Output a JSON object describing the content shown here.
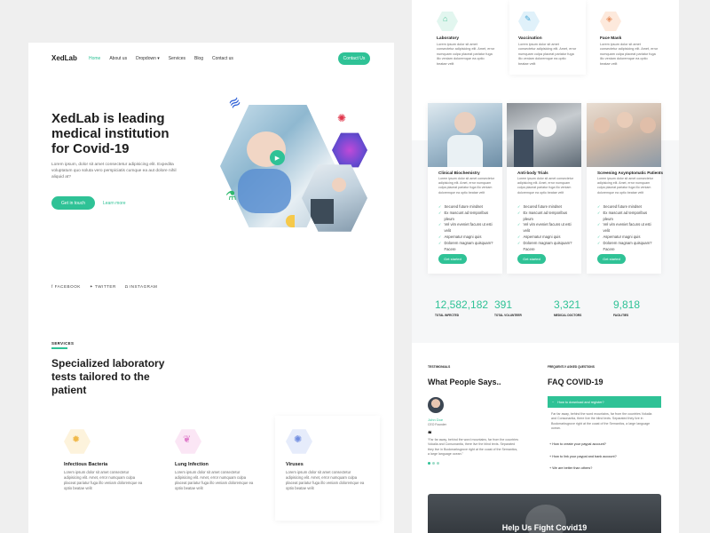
{
  "brand": "XedLab",
  "nav": {
    "items": [
      "Home",
      "About us",
      "Dropdown",
      "Services",
      "Blog",
      "Contact us"
    ],
    "cta": "Contact Us"
  },
  "hero": {
    "title_l1": "XedLab is leading",
    "title_l2": "medical institution",
    "title_l3": "for Covid-19",
    "body": "Lorem ipsum, dolor sit amet consectetur adipisicing elit. Expedita voluptatum quo soluta vero perspiciatis cumque ea aut dolore nihil aliquid at?",
    "cta": "Get in touch",
    "link": "Learn more"
  },
  "social": [
    "FACEBOOK",
    "TWITTER",
    "INSTAGRAM"
  ],
  "services": {
    "eyebrow": "SERVICES",
    "title_l1": "Specialized laboratory",
    "title_l2": "tests tailored to the",
    "title_l3": "patient",
    "items": [
      {
        "title": "Infectious Bacteria",
        "text": "Lorem ipsum dolor sit amet consectetur adipisicing elit. Amet, error numquam culpa placeat pariatur fuga illo veniam doloremque ea optio beatae velit",
        "color": "#f6c96b",
        "bg": "#fdf3dc"
      },
      {
        "title": "Lung Infection",
        "text": "Lorem ipsum dolor sit amet consectetur adipisicing elit. Amet, error numquam culpa placeat pariatur fuga illo veniam doloremque ea optio beatae velit",
        "color": "#e98fd3",
        "bg": "#fbe6f5"
      },
      {
        "title": "Viruses",
        "text": "Lorem ipsum dolor sit amet consectetur adipisicing elit. Amet, error numquam culpa placeat pariatur fuga illo veniam doloremque ea optio beatae velit",
        "color": "#8fa8e9",
        "bg": "#e6ecfb"
      }
    ]
  },
  "top_services": [
    {
      "title": "Laboratory",
      "text": "Lorem ipsum dolor sit amet consectetur adipisicing elit. Amet, error numquam culpa placeat pariatur fuga illo veniam doloremque ea optio beatae velit",
      "color": "#7fd6b8",
      "bg": "#e2f6ef"
    },
    {
      "title": "Vaccination",
      "text": "Lorem ipsum dolor sit amet consectetur adipisicing elit. Amet, error numquam culpa placeat pariatur fuga illo veniam doloremque ea optio beatae velit",
      "color": "#7fc4e6",
      "bg": "#e0f1fa"
    },
    {
      "title": "Face Mask",
      "text": "Lorem ipsum dolor sit amet consectetur adipisicing elit. Amet, error numquam culpa placeat pariatur fuga illo veniam doloremque ea optio beatae velit",
      "color": "#f0a97a",
      "bg": "#fde9dc"
    }
  ],
  "programs": [
    {
      "title": "Clinical Biochemistry",
      "text": "Lorem ipsum dolor sit amet consectetur adipisicing elit. Amet, error numquam culpa placeat pariatur fuga illo veniam doloremque ea optio beatae velit",
      "checks": [
        "Secured future mindset",
        "Ex mascunt ad temporibus pleum",
        "Vel vim eveniet facuns ut esti velit",
        "Aspernatur magni quis",
        "Dolorem magnam quisquam? Facere"
      ],
      "cta": "Get started"
    },
    {
      "title": "Anti-body Trials",
      "text": "Lorem ipsum dolor sit amet consectetur adipisicing elit. Amet, error numquam culpa placeat pariatur fuga illo veniam doloremque ea optio beatae velit",
      "checks": [
        "Secured future mindset",
        "Ex mascunt ad temporibus pleum",
        "Vel vim eveniet facuns ut esti velit",
        "Aspernatur magni quis",
        "Dolorem magnam quisquam? Facere"
      ],
      "cta": "Get started"
    },
    {
      "title": "Screening Asymptomatic Patients",
      "text": "Lorem ipsum dolor sit amet consectetur adipisicing elit. Amet, error numquam culpa placeat pariatur fuga illo veniam doloremque ea optio beatae velit",
      "checks": [
        "Secured future mindset",
        "Ex mascunt ad temporibus pleum",
        "Vel vim eveniet facuns ut esti velit",
        "Aspernatur magni quis",
        "Dolorem magnam quisquam? Facere"
      ],
      "cta": "Get started"
    }
  ],
  "stats": [
    {
      "value": "12,582,182",
      "label": "TOTAL INFECTED"
    },
    {
      "value": "391",
      "label": "TOTAL VOLUNTEER"
    },
    {
      "value": "3,321",
      "label": "MEDICAL DOCTORS"
    },
    {
      "value": "9,818",
      "label": "FACILITIES"
    }
  ],
  "testimonials": {
    "eyebrow": "TESTIMONIALS",
    "title": "What People Says..",
    "name": "John Doe",
    "role": "CEO Founder",
    "quote": "“Far far away, behind the word mountains, far from the countries Vokalia and Consonantia, there live the blind texts. Separated they live in Bookmarksgrove right at the coast of the Semantics, a large language ocean.”"
  },
  "faq": {
    "eyebrow": "FREQUENTLY ASKED QUESTIONS",
    "title": "FAQ COVID-19",
    "open_q": "How to download and register?",
    "open_a": "Far far away, behind the word mountains, far from the countries Vokalia and Consonantia, there live the blind texts. Separated they live in Bookmarksgrove right at the coast of the Semantics, a large language ocean.",
    "items": [
      "How to create your paypal account?",
      "How to link your paypal and bank account?",
      "We are better than others?"
    ]
  },
  "banner": {
    "title": "Help Us Fight Covid19"
  }
}
